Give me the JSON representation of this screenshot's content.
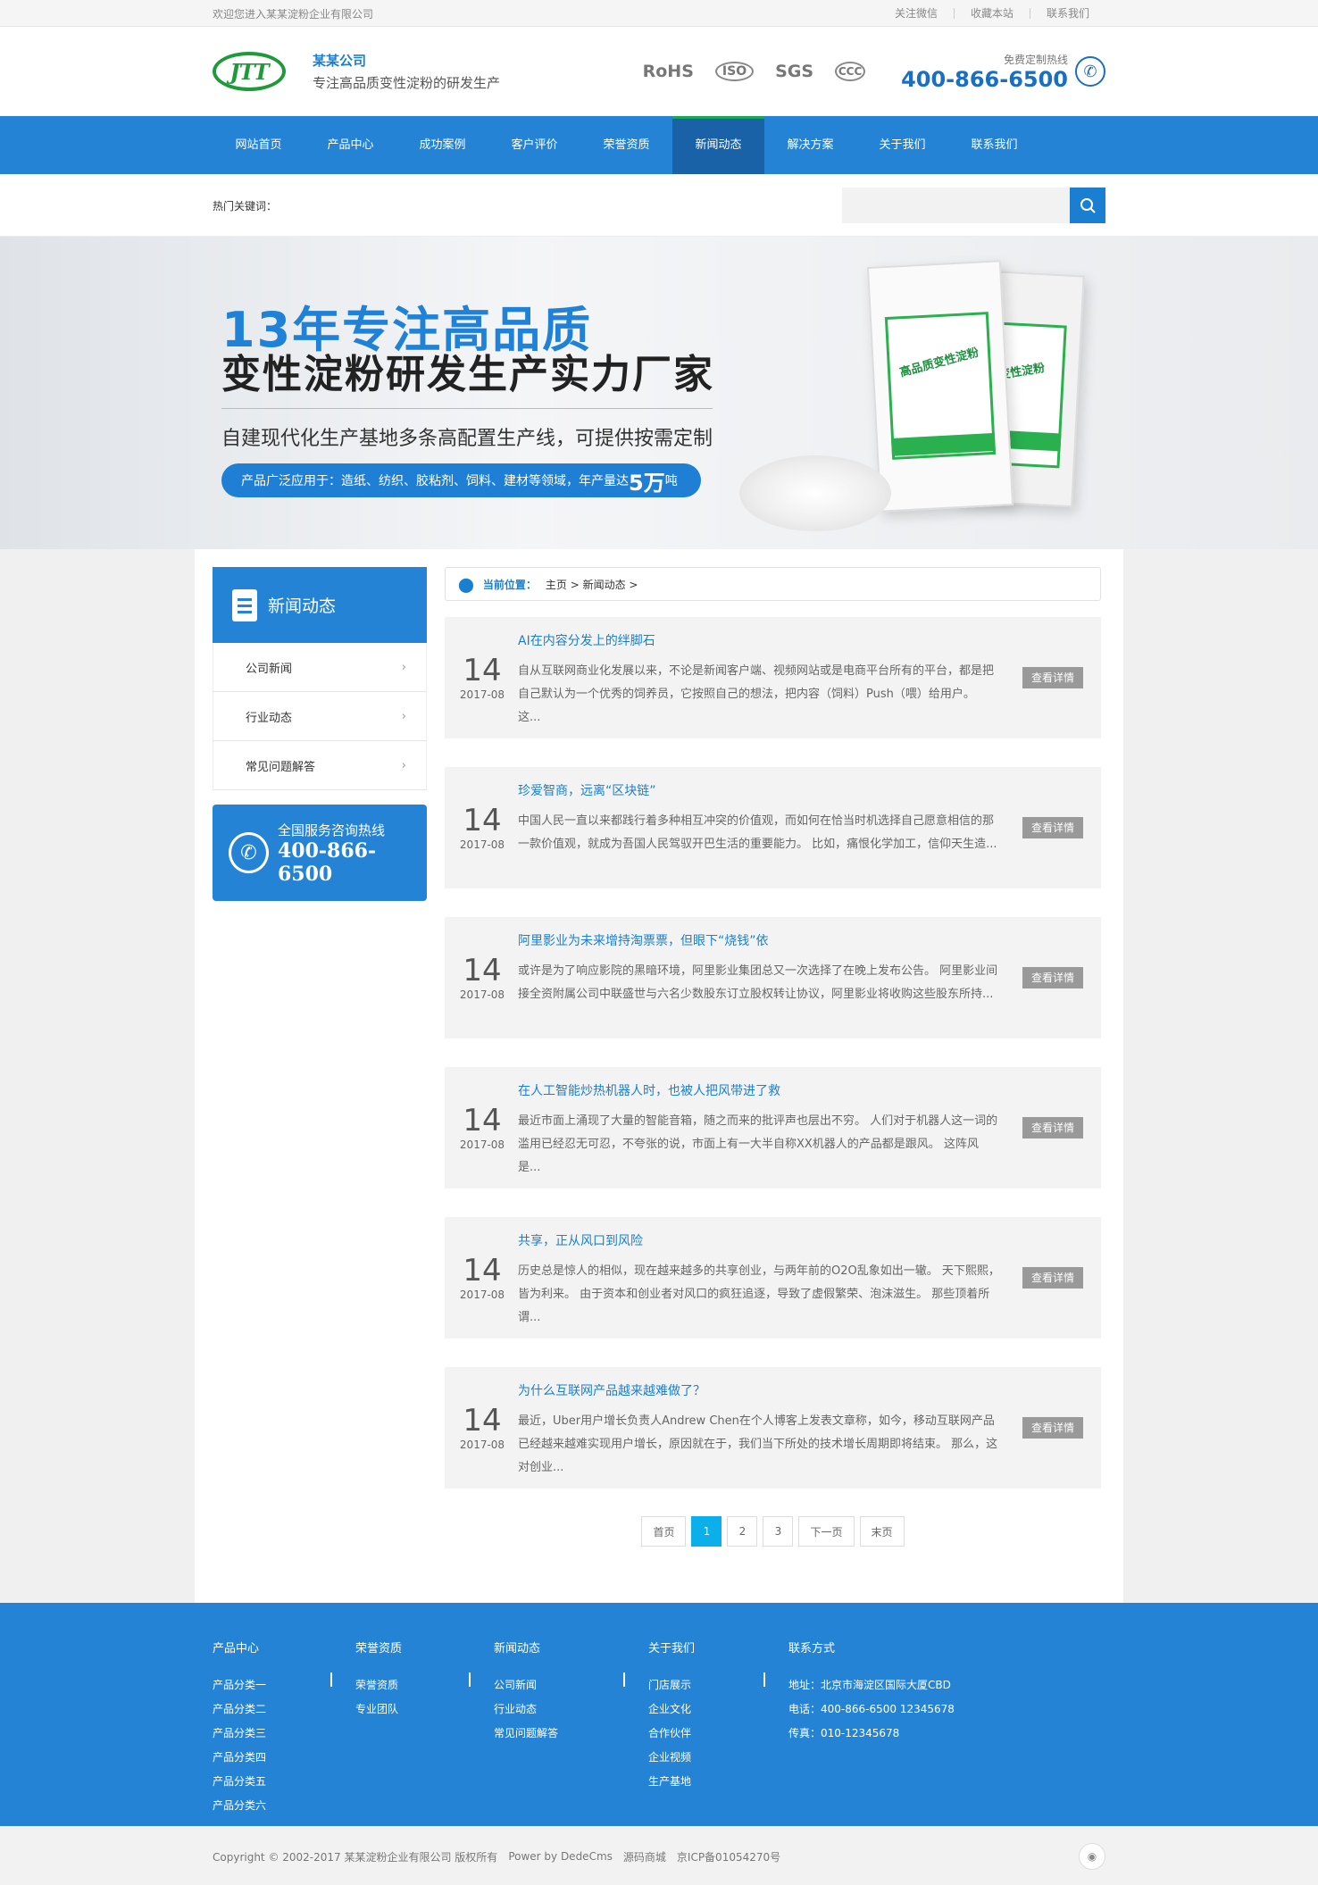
{
  "topbar": {
    "welcome": "欢迎您进入某某淀粉企业有限公司",
    "links": [
      "关注微信",
      "收藏本站",
      "联系我们"
    ]
  },
  "header": {
    "logo_text": "JTT",
    "brand_name": "某某公司",
    "slogan": "专注高品质变性淀粉的研发生产",
    "certs": [
      "RoHS",
      "ISO",
      "SGS",
      "CCC"
    ],
    "hotline_label": "免费定制热线",
    "hotline_number": "400-866-6500"
  },
  "nav": {
    "items": [
      "网站首页",
      "产品中心",
      "成功案例",
      "客户评价",
      "荣誉资质",
      "新闻动态",
      "解决方案",
      "关于我们",
      "联系我们"
    ],
    "active": "新闻动态"
  },
  "search": {
    "hot_keywords_label": "热门关键词：",
    "placeholder": ""
  },
  "banner": {
    "line1": "13年专注高品质",
    "line2": "变性淀粉研发生产实力厂家",
    "line3": "自建现代化生产基地多条高配置生产线，可提供按需定制",
    "pill_prefix": "产品广泛应用于：造纸、纺织、胶粘剂、饲料、建材等领域，年产量达",
    "pill_highlight": "5万",
    "pill_suffix": "吨",
    "bag_label": "高品质变性淀粉",
    "bag2_label": "变性淀粉"
  },
  "sidebar": {
    "title": "新闻动态",
    "items": [
      "公司新闻",
      "行业动态",
      "常见问题解答"
    ],
    "hot_title": "全国服务咨询热线",
    "hot_number": "400-866-6500"
  },
  "breadcrumb": {
    "label": "当前位置：",
    "path": "主页 > 新闻动态 >"
  },
  "news": [
    {
      "day": "14",
      "ym": "2017-08",
      "title": "AI在内容分发上的绊脚石",
      "desc": "自从互联网商业化发展以来，不论是新闻客户端、视频网站或是电商平台所有的平台，都是把自己默认为一个优秀的饲养员，它按照自己的想法，把内容（饲料）Push（喂）给用户。 这...",
      "more": "查看详情"
    },
    {
      "day": "14",
      "ym": "2017-08",
      "title": "珍爱智商，远离“区块链”",
      "desc": "中国人民一直以来都践行着多种相互冲突的价值观，而如何在恰当时机选择自己愿意相信的那一款价值观，就成为吾国人民驾驭开巴生活的重要能力。 比如，痛恨化学加工，信仰天生造...",
      "more": "查看详情"
    },
    {
      "day": "14",
      "ym": "2017-08",
      "title": "阿里影业为未来增持淘票票，但眼下“烧钱”依",
      "desc": "或许是为了响应影院的黑暗环境，阿里影业集团总又一次选择了在晚上发布公告。 阿里影业间接全资附属公司中联盛世与六名少数股东订立股权转让协议，阿里影业将收购这些股东所持...",
      "more": "查看详情"
    },
    {
      "day": "14",
      "ym": "2017-08",
      "title": "在人工智能炒热机器人时，也被人把风带进了救",
      "desc": "最近市面上涌现了大量的智能音箱，随之而来的批评声也层出不穷。 人们对于机器人这一词的滥用已经忍无可忍，不夸张的说，市面上有一大半自称XX机器人的产品都是跟风。 这阵风是...",
      "more": "查看详情"
    },
    {
      "day": "14",
      "ym": "2017-08",
      "title": "共享，正从风口到风险",
      "desc": "历史总是惊人的相似，现在越来越多的共享创业，与两年前的O2O乱象如出一辙。 天下熙熙，皆为利来。 由于资本和创业者对风口的疯狂追逐，导致了虚假繁荣、泡沫滋生。 那些顶着所谓...",
      "more": "查看详情"
    },
    {
      "day": "14",
      "ym": "2017-08",
      "title": "为什么互联网产品越来越难做了？",
      "desc": "最近，Uber用户增长负责人Andrew Chen在个人博客上发表文章称，如今，移动互联网产品已经越来越难实现用户增长，原因就在于，我们当下所处的技术增长周期即将结束。 那么，这对创业...",
      "more": "查看详情"
    }
  ],
  "pager": {
    "first": "首页",
    "pages": [
      "1",
      "2",
      "3"
    ],
    "current": "1",
    "next": "下一页",
    "last": "末页"
  },
  "footer": {
    "cols": [
      {
        "title": "产品中心",
        "items": [
          "产品分类一",
          "产品分类二",
          "产品分类三",
          "产品分类四",
          "产品分类五",
          "产品分类六"
        ]
      },
      {
        "title": "荣誉资质",
        "items": [
          "荣誉资质",
          "专业团队"
        ]
      },
      {
        "title": "新闻动态",
        "items": [
          "公司新闻",
          "行业动态",
          "常见问题解答"
        ]
      },
      {
        "title": "关于我们",
        "items": [
          "门店展示",
          "企业文化",
          "合作伙伴",
          "企业视频",
          "生产基地"
        ]
      },
      {
        "title": "联系方式",
        "items": [
          "地址：北京市海淀区国际大厦CBD",
          "电话：400-866-6500 12345678",
          "传真：010-12345678"
        ]
      }
    ],
    "copyright": "Copyright © 2002-2017 某某淀粉企业有限公司 版权所有",
    "powered": "Power by DedeCms",
    "mall": "源码商城",
    "icp": "京ICP备01054270号"
  },
  "colors": {
    "primary": "#2583d5",
    "nav_active": "#1a62a8",
    "accent_green": "#19a85a",
    "pager_current": "#0bb0ea"
  }
}
